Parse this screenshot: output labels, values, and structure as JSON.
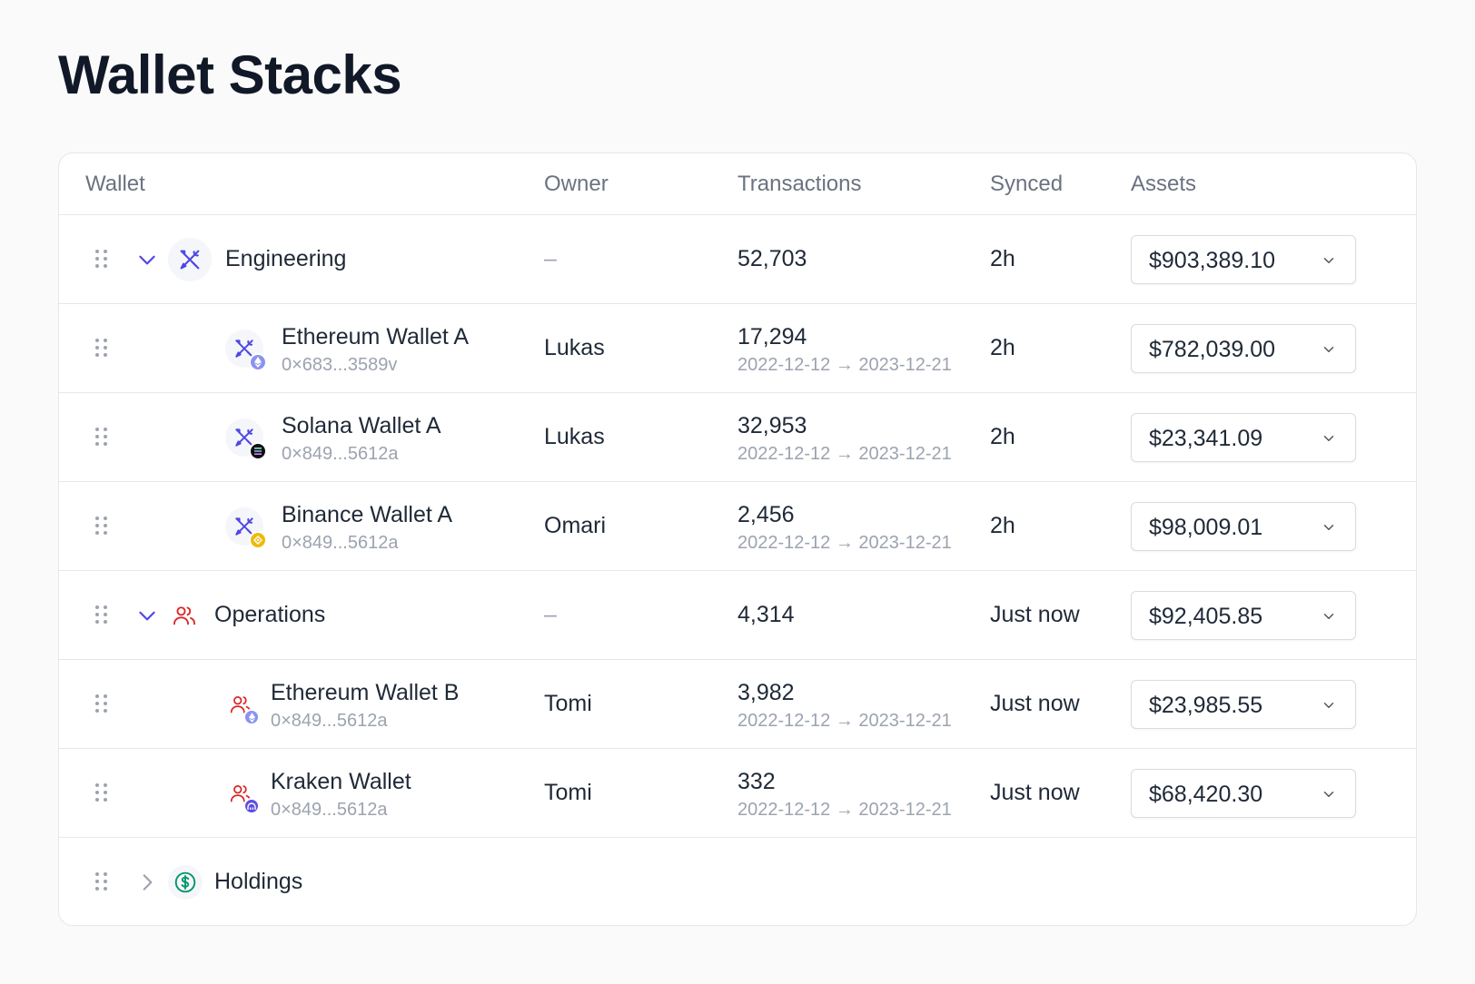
{
  "page": {
    "title": "Wallet Stacks"
  },
  "table": {
    "headers": {
      "wallet": "Wallet",
      "owner": "Owner",
      "transactions": "Transactions",
      "synced": "Synced",
      "assets": "Assets"
    }
  },
  "colors": {
    "engineering_icon": "#4f46e5",
    "operations_icon": "#dc2626",
    "holdings_icon": "#059669",
    "ethereum_badge": "#8b93f0",
    "solana_badge": "#111111",
    "binance_badge": "#f0b90b",
    "kraken_badge": "#5b4fe0"
  },
  "rows": [
    {
      "type": "group",
      "icon": "tools-icon",
      "name": "Engineering",
      "owner": "–",
      "transactions": "52,703",
      "synced": "2h",
      "assets": "$903,389.10",
      "expanded": true
    },
    {
      "type": "wallet",
      "icon": "tools-icon",
      "badge": "ethereum-icon",
      "name": "Ethereum Wallet A",
      "address": "0×683...3589v",
      "owner": "Lukas",
      "transactions": "17,294",
      "range": "2022-12-12 → 2023-12-21",
      "synced": "2h",
      "assets": "$782,039.00"
    },
    {
      "type": "wallet",
      "icon": "tools-icon",
      "badge": "solana-icon",
      "name": "Solana Wallet A",
      "address": "0×849...5612a",
      "owner": "Lukas",
      "transactions": "32,953",
      "range": "2022-12-12 → 2023-12-21",
      "synced": "2h",
      "assets": "$23,341.09"
    },
    {
      "type": "wallet",
      "icon": "tools-icon",
      "badge": "binance-icon",
      "name": "Binance Wallet A",
      "address": "0×849...5612a",
      "owner": "Omari",
      "transactions": "2,456",
      "range": "2022-12-12 → 2023-12-21",
      "synced": "2h",
      "assets": "$98,009.01"
    },
    {
      "type": "group",
      "icon": "users-icon",
      "name": "Operations",
      "owner": "–",
      "transactions": "4,314",
      "synced": "Just now",
      "assets": "$92,405.85",
      "expanded": true
    },
    {
      "type": "wallet",
      "icon": "users-icon",
      "badge": "ethereum-icon",
      "name": "Ethereum Wallet B",
      "address": "0×849...5612a",
      "owner": "Tomi",
      "transactions": "3,982",
      "range": "2022-12-12 → 2023-12-21",
      "synced": "Just now",
      "assets": "$23,985.55"
    },
    {
      "type": "wallet",
      "icon": "users-icon",
      "badge": "kraken-icon",
      "name": "Kraken Wallet",
      "address": "0×849...5612a",
      "owner": "Tomi",
      "transactions": "332",
      "range": "2022-12-12 → 2023-12-21",
      "synced": "Just now",
      "assets": "$68,420.30"
    },
    {
      "type": "group",
      "icon": "dollar-icon",
      "name": "Holdings",
      "expanded": false
    }
  ]
}
